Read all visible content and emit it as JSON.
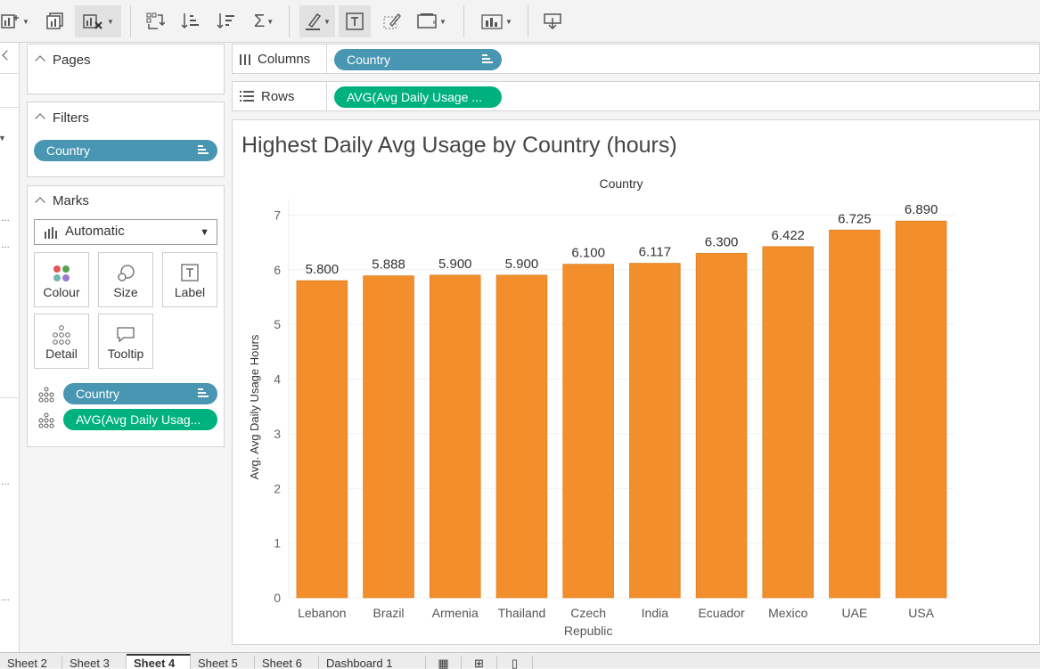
{
  "sidebar": {
    "pages_title": "Pages",
    "filters_title": "Filters",
    "filter_pill": "Country",
    "marks_title": "Marks",
    "mark_type": "Automatic",
    "mark_buttons": [
      "Colour",
      "Size",
      "Label",
      "Detail",
      "Tooltip"
    ],
    "mark_pills": [
      "Country",
      "AVG(Avg Daily Usag..."
    ]
  },
  "shelves": {
    "columns_label": "Columns",
    "columns_pill": "Country",
    "rows_label": "Rows",
    "rows_pill": "AVG(Avg Daily Usage ..."
  },
  "tabs": [
    "Sheet 2",
    "Sheet 3",
    "Sheet 4",
    "Sheet 5",
    "Sheet 6",
    "Dashboard 1"
  ],
  "active_tab": "Sheet 4",
  "colors": {
    "bar": "#f28e2b",
    "pill_blue": "#4996b2",
    "pill_green": "#00b180"
  },
  "chart_data": {
    "type": "bar",
    "title": "Highest Daily Avg Usage by Country (hours)",
    "xlabel": "Country",
    "ylabel": "Avg. Avg Daily Usage Hours",
    "categories": [
      "Lebanon",
      "Brazil",
      "Armenia",
      "Thailand",
      "Czech Republic",
      "India",
      "Ecuador",
      "Mexico",
      "UAE",
      "USA"
    ],
    "values": [
      5.8,
      5.888,
      5.9,
      5.9,
      6.1,
      6.117,
      6.3,
      6.422,
      6.725,
      6.89
    ],
    "value_labels": [
      "5.800",
      "5.888",
      "5.900",
      "5.900",
      "6.100",
      "6.117",
      "6.300",
      "6.422",
      "6.725",
      "6.890"
    ],
    "yticks": [
      "0",
      "1",
      "2",
      "3",
      "4",
      "5",
      "6",
      "7"
    ],
    "ylim": [
      0,
      7.3
    ],
    "grid": true,
    "legend": "none"
  }
}
